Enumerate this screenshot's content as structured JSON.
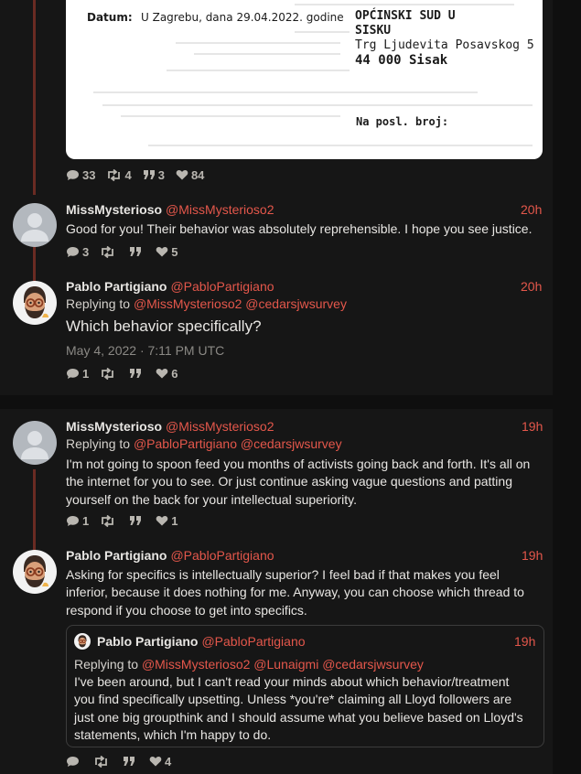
{
  "document_image": {
    "datum_label": "Datum:",
    "datum_value": "U Zagrebu, dana 29.04.2022. godine",
    "court_lines": [
      "OPĆINSKI SUD U",
      "SISKU",
      "Trg Ljudevita Posavskog 5",
      "44 000 Sisak"
    ],
    "posl_label": "Na posl. broj:"
  },
  "tweets": [
    {
      "stats": {
        "replies": "33",
        "retweets": "4",
        "quotes": "3",
        "likes": "84"
      }
    },
    {
      "name": "MissMysterioso",
      "handle": "@MissMysterioso2",
      "time": "20h",
      "content": "Good for you! Their behavior was absolutely reprehensible. I hope you see justice.",
      "stats": {
        "replies": "3",
        "retweets": "",
        "quotes": "",
        "likes": "5"
      }
    },
    {
      "name": "Pablo Partigiano",
      "handle": "@PabloPartigiano",
      "time": "20h",
      "replying_label": "Replying to",
      "replying_to": [
        "@MissMysterioso2",
        "@cedarsjwsurvey"
      ],
      "content": "Which behavior specifically?",
      "date": "May 4, 2022 · 7:11 PM UTC",
      "stats": {
        "replies": "1",
        "retweets": "",
        "quotes": "",
        "likes": "6"
      }
    },
    {
      "name": "MissMysterioso",
      "handle": "@MissMysterioso2",
      "time": "19h",
      "replying_label": "Replying to",
      "replying_to": [
        "@PabloPartigiano",
        "@cedarsjwsurvey"
      ],
      "content_lines": [
        "I'm not going to spoon feed you months of activists going back and forth. It's all on",
        "the internet for you to see. Or just continue asking vague questions and patting",
        "yourself on the back for your intellectual superiority."
      ],
      "stats": {
        "replies": "1",
        "retweets": "",
        "quotes": "",
        "likes": "1"
      }
    },
    {
      "name": "Pablo Partigiano",
      "handle": "@PabloPartigiano",
      "time": "19h",
      "content_lines": [
        "Asking for specifics is intellectually superior? I feel bad if that makes you feel",
        "inferior, because it does nothing for me. Anyway, you can choose which thread to",
        "respond if you choose to get into specifics."
      ],
      "quote": {
        "name": "Pablo Partigiano",
        "handle": "@PabloPartigiano",
        "time": "19h",
        "replying_label": "Replying to",
        "replying_to": [
          "@MissMysterioso2",
          "@Lunaigmi",
          "@cedarsjwsurvey"
        ],
        "content_lines": [
          "I've been around, but I can't read your minds about which behavior/treatment",
          "you find specifically upsetting. Unless *you're* claiming all Lloyd followers are",
          "just one big groupthink and I should assume what you believe based on Lloyd's",
          "statements, which I'm happy to do."
        ]
      },
      "stats": {
        "replies": "",
        "retweets": "",
        "quotes": "",
        "likes": "4"
      }
    }
  ],
  "colors": {
    "accent": "#e4574b",
    "background": "#0f0f0f",
    "panel": "#161616",
    "thread_line": "#6a2b23"
  }
}
